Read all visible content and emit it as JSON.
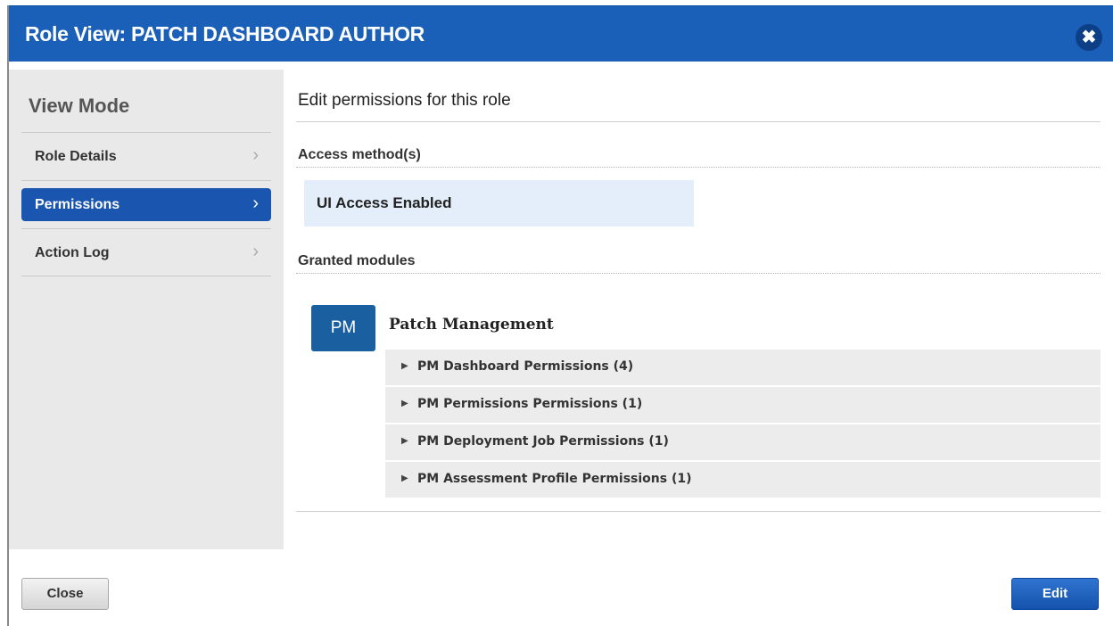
{
  "dialog": {
    "title": "Role View: PATCH DASHBOARD AUTHOR",
    "close_icon": "✖"
  },
  "sidebar": {
    "title": "View Mode",
    "items": [
      {
        "label": "Role Details",
        "active": false
      },
      {
        "label": "Permissions",
        "active": true
      },
      {
        "label": "Action Log",
        "active": false
      }
    ],
    "chevron": "›"
  },
  "main": {
    "heading": "Edit permissions for this role",
    "access_label": "Access method(s)",
    "access_value": "UI Access Enabled",
    "modules_label": "Granted modules",
    "module": {
      "icon_text": "PM",
      "name": "Patch Management",
      "permissions": [
        "PM Dashboard Permissions (4)",
        "PM Permissions Permissions (1)",
        "PM Deployment Job Permissions (1)",
        "PM Assessment Profile Permissions (1)"
      ],
      "expand_icon": "▶"
    }
  },
  "footer": {
    "close_label": "Close",
    "edit_label": "Edit"
  },
  "colors": {
    "title_bar": "#1a5fb8",
    "active_nav": "#1a56b0",
    "access_box": "#e3eefa",
    "module_icon": "#1a5fa0"
  }
}
